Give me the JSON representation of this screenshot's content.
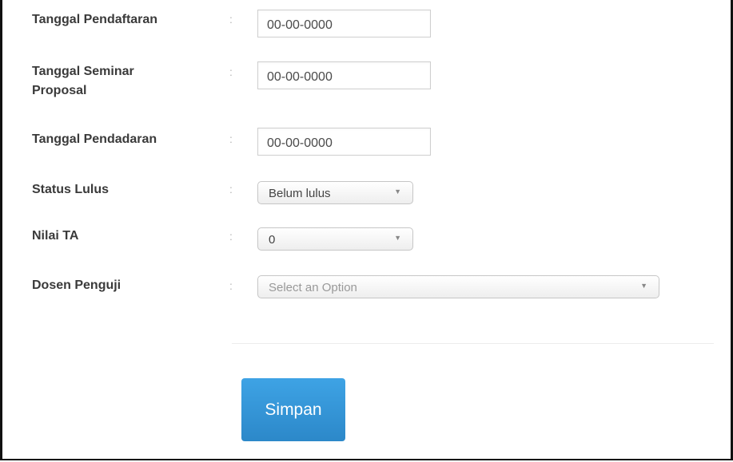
{
  "form": {
    "fields": [
      {
        "label": "Tanggal Pendaftaran",
        "colon": ":",
        "value": "00-00-0000"
      },
      {
        "label": "Tanggal Seminar Proposal",
        "colon": ":",
        "value": "00-00-0000"
      },
      {
        "label": "Tanggal Pendadaran",
        "colon": ":",
        "value": "00-00-0000"
      },
      {
        "label": "Status Lulus",
        "colon": ":",
        "selected": "Belum lulus"
      },
      {
        "label": "Nilai TA",
        "colon": ":",
        "selected": "0"
      },
      {
        "label": "Dosen Penguji",
        "colon": ":",
        "placeholder": "Select an Option"
      }
    ],
    "dropdown_arrow": "▼",
    "submit_label": "Simpan"
  },
  "colors": {
    "button_blue": "#2f8fd3",
    "label_text": "#3a3a3a",
    "border": "#cfcfcf"
  },
  "icons": [
    "chevron-down-icon"
  ]
}
